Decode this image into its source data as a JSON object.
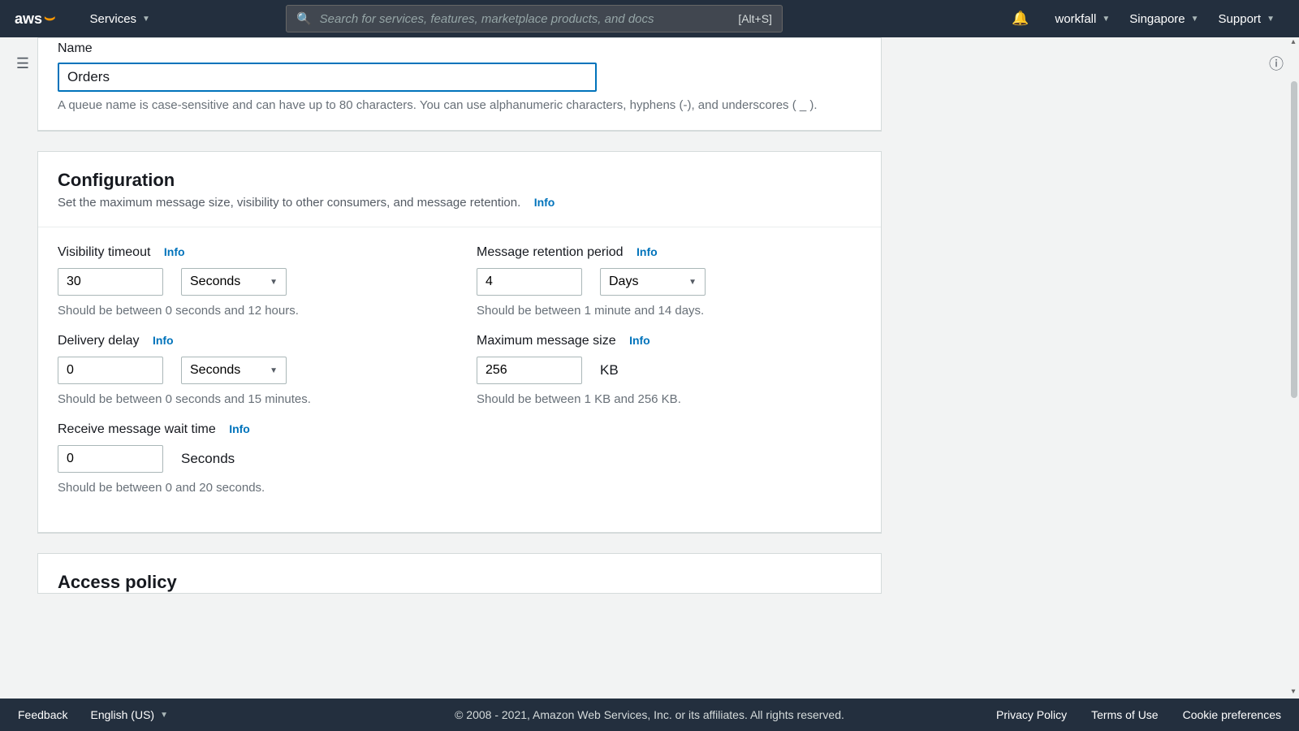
{
  "nav": {
    "logo_text": "aws",
    "services": "Services",
    "search_placeholder": "Search for services, features, marketplace products, and docs",
    "search_shortcut": "[Alt+S]",
    "user": "workfall",
    "region": "Singapore",
    "support": "Support"
  },
  "name_section": {
    "label": "Name",
    "value": "Orders",
    "hint": "A queue name is case-sensitive and can have up to 80 characters. You can use alphanumeric characters, hyphens (-), and underscores ( _ )."
  },
  "config": {
    "title": "Configuration",
    "desc": "Set the maximum message size, visibility to other consumers, and message retention.",
    "info": "Info",
    "visibility": {
      "label": "Visibility timeout",
      "value": "30",
      "unit": "Seconds",
      "hint": "Should be between 0 seconds and 12 hours."
    },
    "retention": {
      "label": "Message retention period",
      "value": "4",
      "unit": "Days",
      "hint": "Should be between 1 minute and 14 days."
    },
    "delay": {
      "label": "Delivery delay",
      "value": "0",
      "unit": "Seconds",
      "hint": "Should be between 0 seconds and 15 minutes."
    },
    "maxsize": {
      "label": "Maximum message size",
      "value": "256",
      "unit": "KB",
      "hint": "Should be between 1 KB and 256 KB."
    },
    "wait": {
      "label": "Receive message wait time",
      "value": "0",
      "unit": "Seconds",
      "hint": "Should be between 0 and 20 seconds."
    }
  },
  "access": {
    "title": "Access policy"
  },
  "footer": {
    "feedback": "Feedback",
    "lang": "English (US)",
    "copy": "© 2008 - 2021, Amazon Web Services, Inc. or its affiliates. All rights reserved.",
    "privacy": "Privacy Policy",
    "terms": "Terms of Use",
    "cookies": "Cookie preferences"
  }
}
